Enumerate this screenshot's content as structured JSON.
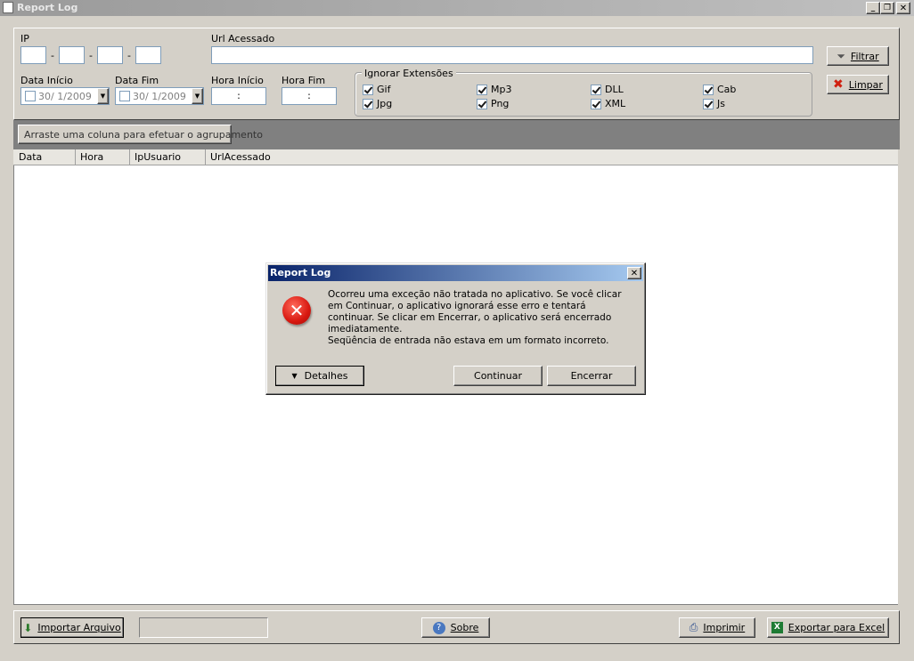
{
  "window": {
    "title": "Report Log"
  },
  "filters": {
    "ip_label": "IP",
    "ip_sep": "-",
    "url_label": "Url Acessado",
    "url_value": "",
    "date_start_label": "Data Início",
    "date_start_value": "30/ 1/2009",
    "date_end_label": "Data Fim",
    "date_end_value": "30/ 1/2009",
    "hour_start_label": "Hora Início",
    "hour_start_value": ":",
    "hour_end_label": "Hora Fim",
    "hour_end_value": ":",
    "ignore_ext_label": "Ignorar Extensões",
    "extensions": [
      {
        "label": "Gif",
        "checked": true
      },
      {
        "label": "Mp3",
        "checked": true
      },
      {
        "label": "DLL",
        "checked": true
      },
      {
        "label": "Cab",
        "checked": true
      },
      {
        "label": "Jpg",
        "checked": true
      },
      {
        "label": "Png",
        "checked": true
      },
      {
        "label": "XML",
        "checked": true
      },
      {
        "label": "Js",
        "checked": true
      }
    ],
    "filter_button": "Filtrar",
    "clear_button": "Limpar"
  },
  "grid": {
    "group_hint": "Arraste uma coluna para efetuar o agrupamento",
    "columns": [
      "Data",
      "Hora",
      "IpUsuario",
      "UrlAcessado"
    ]
  },
  "dialog": {
    "title": "Report Log",
    "message": "Ocorreu uma exceção não tratada no aplicativo. Se você clicar em Continuar, o aplicativo ignorará esse erro e tentará continuar. Se clicar em Encerrar, o aplicativo será encerrado imediatamente.",
    "detail": "Seqüência de entrada não estava em um formato incorreto.",
    "details_button": "Detalhes",
    "continue_button": "Continuar",
    "quit_button": "Encerrar"
  },
  "footer": {
    "import_button": "Importar Arquivo",
    "about_button": "Sobre",
    "print_button": "Imprimir",
    "export_button": "Exportar para Excel"
  },
  "colors": {
    "titlebar": "#a8a8a8",
    "dialog_title_start": "#0a246a",
    "dialog_title_end": "#a6caf0",
    "error_red": "#e0201c"
  }
}
